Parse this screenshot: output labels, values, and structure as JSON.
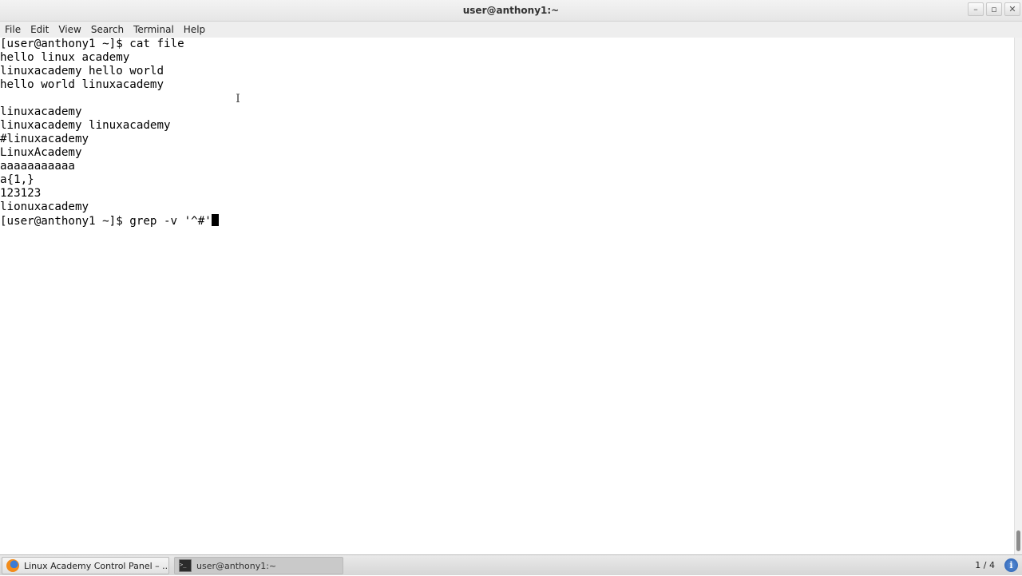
{
  "window": {
    "title": "user@anthony1:~",
    "controls": [
      "minimize-icon",
      "maximize-icon",
      "close-icon"
    ]
  },
  "menubar": {
    "items": [
      "File",
      "Edit",
      "View",
      "Search",
      "Terminal",
      "Help"
    ]
  },
  "terminal": {
    "lines": [
      "[user@anthony1 ~]$ cat file",
      "hello linux academy",
      "linuxacademy hello world",
      "hello world linuxacademy",
      "",
      "linuxacademy",
      "linuxacademy linuxacademy",
      "#linuxacademy",
      "LinuxAcademy",
      "aaaaaaaaaaa",
      "a{1,}",
      "123123",
      "lionuxacademy"
    ],
    "prompt_line": "[user@anthony1 ~]$ grep -v '^#'"
  },
  "taskbar": {
    "tasks": [
      {
        "label": "Linux Academy Control Panel – ...",
        "icon": "firefox-icon"
      },
      {
        "label": "user@anthony1:~",
        "icon": "terminal-icon"
      }
    ],
    "workspace_pager": "1 / 4",
    "info_icon": "info-icon"
  }
}
